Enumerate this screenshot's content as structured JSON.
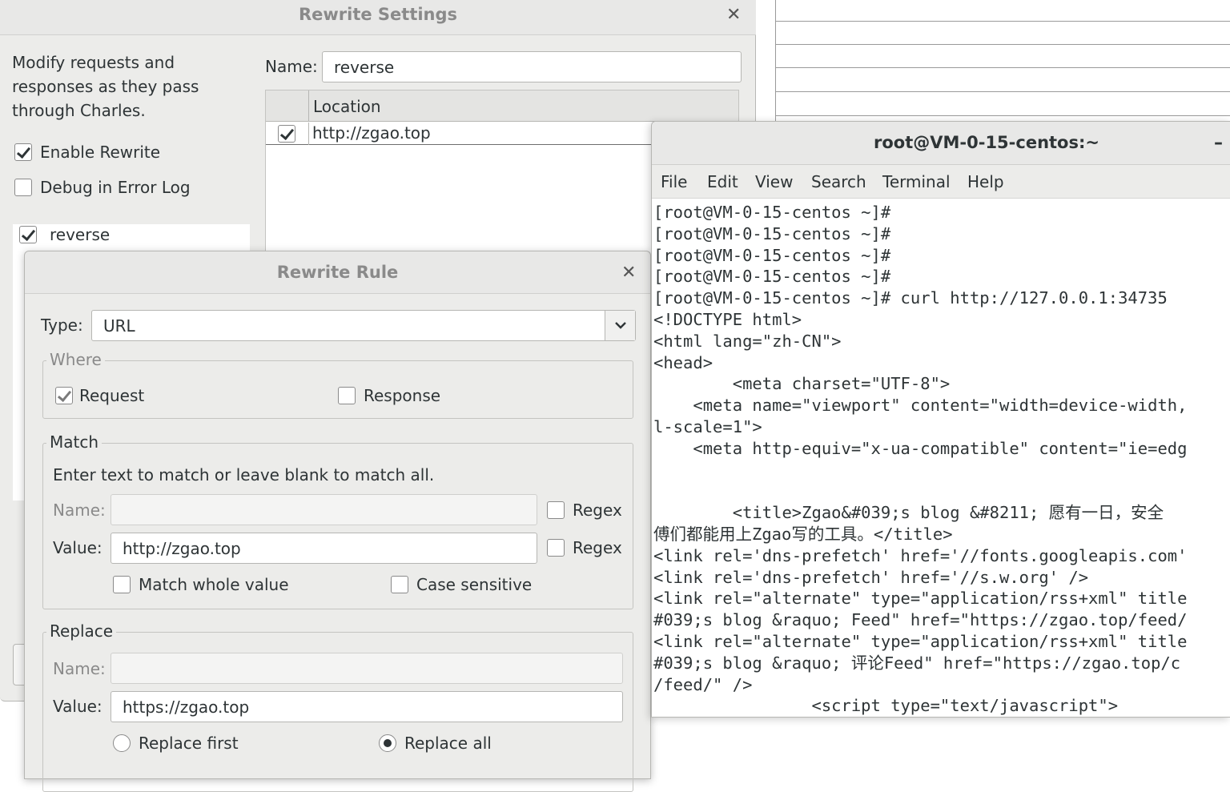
{
  "rewrite_settings": {
    "title": "Rewrite Settings",
    "description_lines": [
      "Modify requests and",
      "responses as they pass",
      "through Charles."
    ],
    "enable_rewrite_label": "Enable Rewrite",
    "debug_label": "Debug in Error Log",
    "sets": [
      {
        "name": "reverse",
        "enabled": true
      }
    ],
    "name_label": "Name:",
    "name_value": "reverse",
    "location_header": "Location",
    "locations": [
      {
        "url": "http://zgao.top",
        "enabled": true
      }
    ]
  },
  "rewrite_rule": {
    "title": "Rewrite Rule",
    "type_label": "Type:",
    "type_value": "URL",
    "where_title": "Where",
    "request_label": "Request",
    "response_label": "Response",
    "match_title": "Match",
    "match_hint": "Enter text to match or leave blank to match all.",
    "name_label": "Name:",
    "value_label": "Value:",
    "match_name_value": "",
    "match_value": "http://zgao.top",
    "regex_label": "Regex",
    "match_whole_label": "Match whole value",
    "case_sensitive_label": "Case sensitive",
    "replace_title": "Replace",
    "replace_name_value": "",
    "replace_value": "https://zgao.top",
    "replace_first_label": "Replace first",
    "replace_all_label": "Replace all"
  },
  "terminal": {
    "title": "root@VM-0-15-centos:~",
    "minimize": "–",
    "menu": [
      "File",
      "Edit",
      "View",
      "Search",
      "Terminal",
      "Help"
    ],
    "lines": [
      "[root@VM-0-15-centos ~]#",
      "[root@VM-0-15-centos ~]#",
      "[root@VM-0-15-centos ~]#",
      "[root@VM-0-15-centos ~]#",
      "[root@VM-0-15-centos ~]# curl http://127.0.0.1:34735",
      "<!DOCTYPE html>",
      "<html lang=\"zh-CN\">",
      "<head>",
      "        <meta charset=\"UTF-8\">",
      "    <meta name=\"viewport\" content=\"width=device-width,",
      "l-scale=1\">",
      "    <meta http-equiv=\"x-ua-compatible\" content=\"ie=edg",
      "",
      "",
      "        <title>Zgao&#039;s blog &#8211; 愿有一日，安全",
      "傅们都能用上Zgao写的工具。</title>",
      "<link rel='dns-prefetch' href='//fonts.googleapis.com'",
      "<link rel='dns-prefetch' href='//s.w.org' />",
      "<link rel=\"alternate\" type=\"application/rss+xml\" title",
      "#039;s blog &raquo; Feed\" href=\"https://zgao.top/feed/",
      "<link rel=\"alternate\" type=\"application/rss+xml\" title",
      "#039;s blog &raquo; 评论Feed\" href=\"https://zgao.top/c",
      "/feed/\" />",
      "                <script type=\"text/javascript\">"
    ]
  }
}
